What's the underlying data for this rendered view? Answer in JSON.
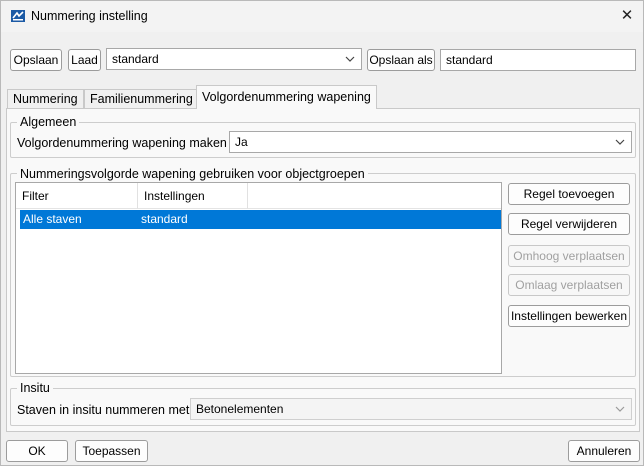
{
  "window": {
    "title": "Nummering instelling"
  },
  "toolbar": {
    "save_label": "Opslaan",
    "load_label": "Laad",
    "preset_value": "standard",
    "save_as_label": "Opslaan als",
    "save_as_value": "standard"
  },
  "tabs": [
    {
      "label": "Nummering",
      "active": false
    },
    {
      "label": "Familienummering",
      "active": false
    },
    {
      "label": "Volgordenummering wapening",
      "active": true
    }
  ],
  "general": {
    "title": "Algemeen",
    "make_label": "Volgordenummering wapening maken",
    "make_value": "Ja"
  },
  "order": {
    "title": "Nummeringsvolgorde wapening gebruiken voor objectgroepen",
    "columns": [
      "Filter",
      "Instellingen"
    ],
    "rows": [
      {
        "filter": "Alle staven",
        "settings": "standard",
        "selected": true
      }
    ],
    "add_rule": "Regel toevoegen",
    "remove_rule": "Regel verwijderen",
    "move_up": "Omhoog verplaatsen",
    "move_down": "Omlaag verplaatsen",
    "edit_settings": "Instellingen bewerken"
  },
  "insitu": {
    "title": "Insitu",
    "label": "Staven in insitu nummeren met",
    "value": "Betonelementen"
  },
  "footer": {
    "ok": "OK",
    "apply": "Toepassen",
    "cancel": "Annuleren"
  },
  "colors": {
    "selection": "#0078d7",
    "background": "#f0f0f0"
  }
}
